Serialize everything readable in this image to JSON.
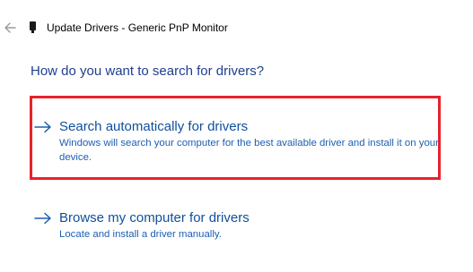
{
  "header": {
    "title": "Update Drivers - Generic PnP Monitor",
    "back_icon": "back-arrow-icon",
    "device_icon": "monitor-icon"
  },
  "heading": "How do you want to search for drivers?",
  "options": [
    {
      "title": "Search automatically for drivers",
      "description": "Windows will search your computer for the best available driver and install it on your device.",
      "icon": "right-arrow-icon",
      "highlighted": true
    },
    {
      "title": "Browse my computer for drivers",
      "description": "Locate and install a driver manually.",
      "icon": "right-arrow-icon",
      "highlighted": false
    }
  ],
  "colors": {
    "link": "#0f4f9e",
    "heading": "#1f3e8f",
    "highlight": "#e6232b"
  }
}
